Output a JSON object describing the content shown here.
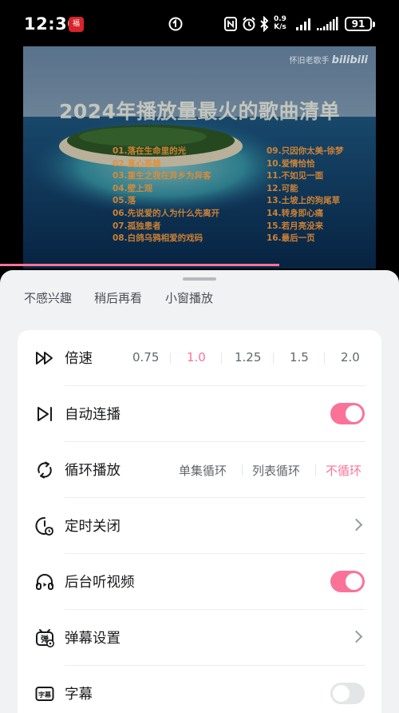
{
  "status_bar": {
    "time": "12:30",
    "app_badge": "福",
    "net_speed_value": "0.9",
    "net_speed_unit": "K/s",
    "battery": "91"
  },
  "video": {
    "watermark_text": "怀旧老歌手",
    "watermark_logo": "bilibili",
    "title": "2024年播放量最火的歌曲清单",
    "songs_left": [
      "01.落在生命里的光",
      "02.真心英雄",
      "03.重生之我在异乡为异客",
      "04.壁上观",
      "05.落",
      "06.先说爱的人为什么先离开",
      "07.孤独患者",
      "08.白鸽乌鸦相爱的戏码"
    ],
    "songs_right": [
      "09.只因你太美-徐梦",
      "10.爱情恰恰",
      "11.不如见一面",
      "12.可能",
      "13.土坡上的狗尾草",
      "14.转身即心痛",
      "15.若月亮没来",
      "16.最后一页"
    ],
    "progress": 0.7
  },
  "sheet": {
    "quick_actions": [
      "不感兴趣",
      "稍后再看",
      "小窗播放"
    ],
    "speed": {
      "label": "倍速",
      "options": [
        "0.75",
        "1.0",
        "1.25",
        "1.5",
        "2.0"
      ],
      "selected": "1.0"
    },
    "autoplay": {
      "label": "自动连播",
      "on": true
    },
    "loop": {
      "label": "循环播放",
      "options": [
        "单集循环",
        "列表循环",
        "不循环"
      ],
      "selected": "不循环"
    },
    "timer": {
      "label": "定时关闭"
    },
    "background_play": {
      "label": "后台听视频",
      "on": true
    },
    "danmaku": {
      "label": "弹幕设置"
    },
    "subtitle": {
      "label": "字幕",
      "icon_text": "字幕",
      "on": false
    },
    "accent_color": "#fb7299"
  }
}
